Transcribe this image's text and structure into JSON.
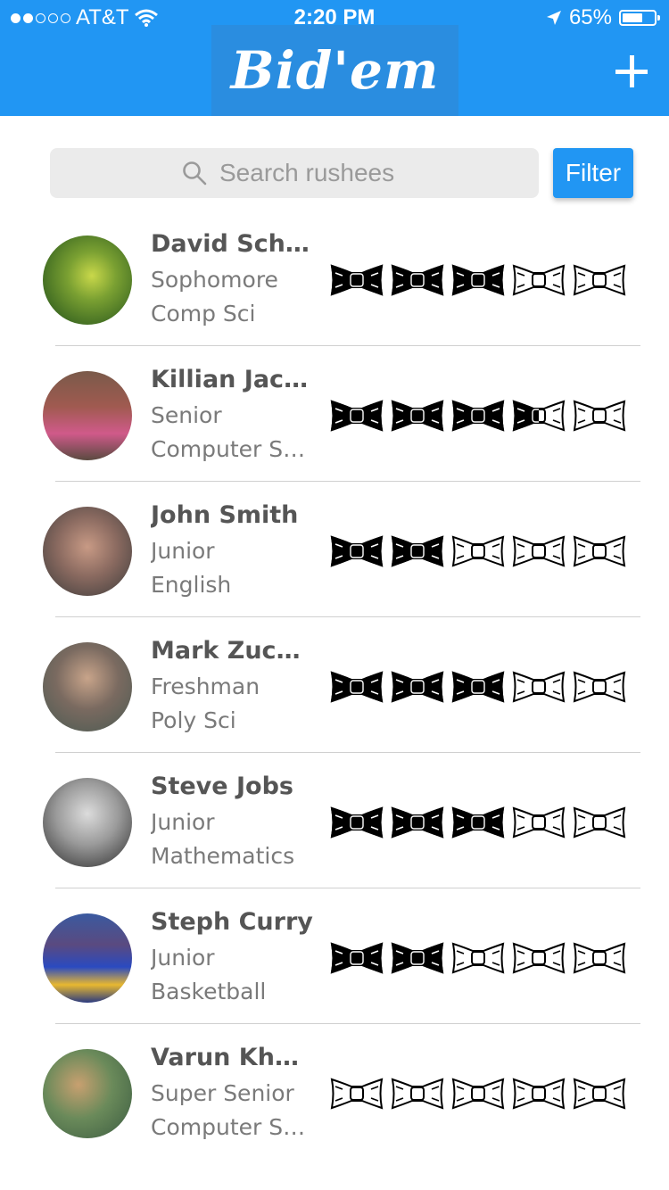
{
  "status_bar": {
    "carrier": "AT&T",
    "time": "2:20 PM",
    "battery": "65%",
    "battery_level": 0.65,
    "signal_bars_filled": 2,
    "signal_bars_total": 5
  },
  "header": {
    "logo": "Bid'em",
    "add_icon": "plus-icon",
    "color": "#2196F3"
  },
  "search": {
    "placeholder": "Search rushees",
    "value": ""
  },
  "filter": {
    "label": "Filter"
  },
  "rating_icon": "bowtie-icon",
  "rating_max": 5,
  "rushees": [
    {
      "name": "David Sche...",
      "year": "Sophomore",
      "major": "Comp Sci",
      "rating": 3
    },
    {
      "name": "Killian Jack...",
      "year": "Senior",
      "major": "Computer Sc...",
      "rating": 3.5
    },
    {
      "name": "John Smith",
      "year": "Junior",
      "major": "English",
      "rating": 2
    },
    {
      "name": "Mark Zuck...",
      "year": "Freshman",
      "major": "Poly Sci",
      "rating": 3
    },
    {
      "name": "Steve Jobs",
      "year": "Junior",
      "major": "Mathematics",
      "rating": 3
    },
    {
      "name": "Steph Curry",
      "year": "Junior",
      "major": "Basketball",
      "rating": 2
    },
    {
      "name": "Varun Khu...",
      "year": "Super Senior",
      "major": "Computer Sc...",
      "rating": 0
    }
  ]
}
